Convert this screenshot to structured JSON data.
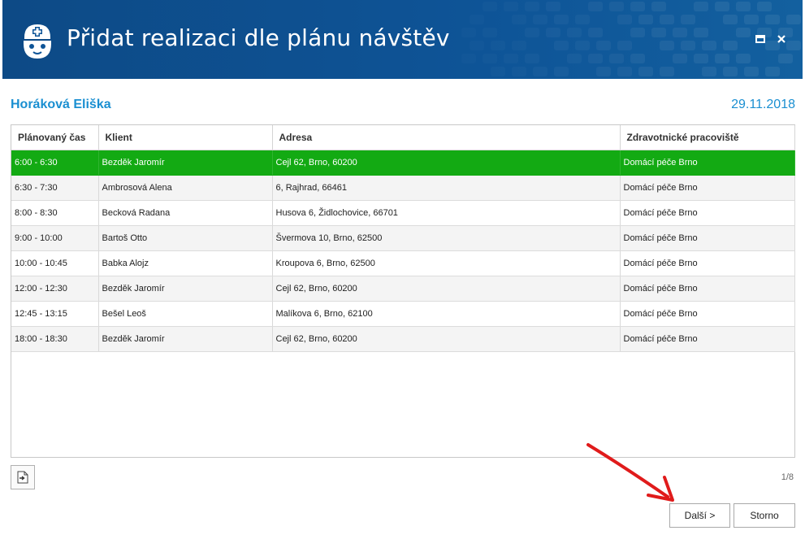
{
  "window": {
    "title": "Přidat realizaci dle plánu návštěv",
    "icon": "nurse-icon"
  },
  "person": {
    "name": "Horáková Eliška",
    "date": "29.11.2018"
  },
  "table": {
    "columns": [
      "Plánovaný čas",
      "Klient",
      "Adresa",
      "Zdravotnické pracoviště"
    ],
    "rows": [
      [
        "6:00 - 6:30",
        "Bezděk Jaromír",
        "Cejl 62, Brno, 60200",
        "Domácí péče Brno"
      ],
      [
        "6:30 - 7:30",
        "Ambrosová Alena",
        "6, Rajhrad, 66461",
        "Domácí péče Brno"
      ],
      [
        "8:00 - 8:30",
        "Becková Radana",
        "Husova 6, Židlochovice, 66701",
        "Domácí péče Brno"
      ],
      [
        "9:00 - 10:00",
        "Bartoš Otto",
        "Švermova 10, Brno, 62500",
        "Domácí péče Brno"
      ],
      [
        "10:00 - 10:45",
        "Babka Alojz",
        "Kroupova 6, Brno, 62500",
        "Domácí péče Brno"
      ],
      [
        "12:00 - 12:30",
        "Bezděk Jaromír",
        "Cejl 62, Brno, 60200",
        "Domácí péče Brno"
      ],
      [
        "12:45 - 13:15",
        "Bešel Leoš",
        "Malíkova 6, Brno, 62100",
        "Domácí péče Brno"
      ],
      [
        "18:00 - 18:30",
        "Bezděk Jaromír",
        "Cejl 62, Brno, 60200",
        "Domácí péče Brno"
      ]
    ],
    "selected_row": 0
  },
  "footer": {
    "page_counter": "1/8",
    "export_icon": "export-icon"
  },
  "buttons": {
    "next": "Další >",
    "cancel": "Storno"
  },
  "colors": {
    "header_bg": "#0e5497",
    "accent_text": "#1a8fd1",
    "selected_row": "#13aa13",
    "annotation_arrow": "#e01b1b"
  }
}
